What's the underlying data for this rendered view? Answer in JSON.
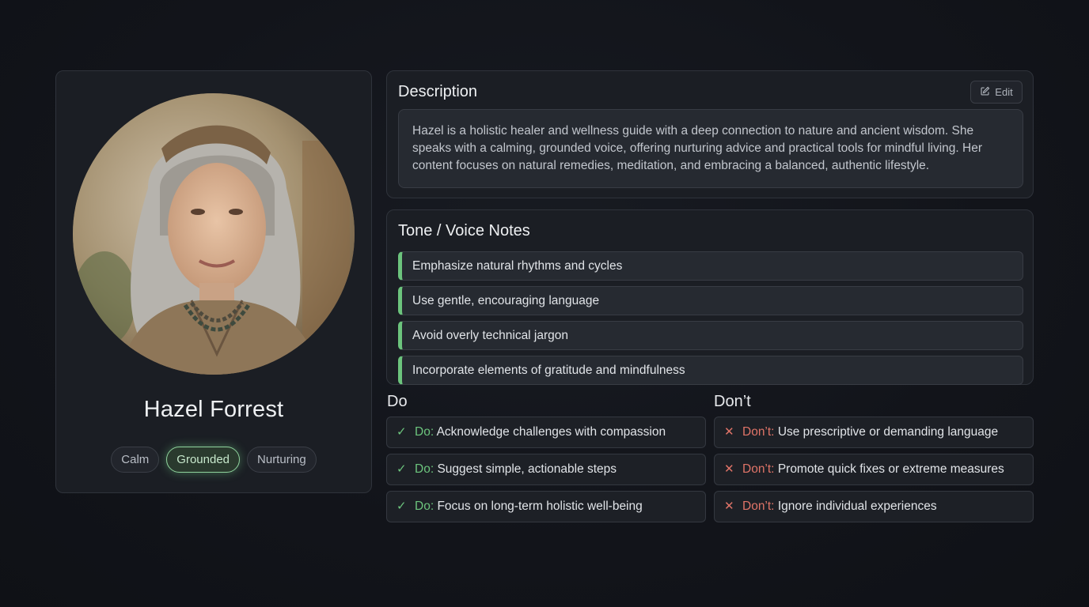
{
  "profile": {
    "name": "Hazel Forrest",
    "tags": [
      "Calm",
      "Grounded",
      "Nurturing"
    ],
    "active_tag": "Grounded"
  },
  "description": {
    "title": "Description",
    "edit_label": "Edit",
    "text": "Hazel is a holistic healer and wellness guide with a deep connection to nature and ancient wisdom. She speaks with a calming, grounded voice, offering nurturing advice and practical tools for mindful living. Her content focuses on natural remedies, meditation, and embracing a balanced, authentic lifestyle."
  },
  "tone": {
    "title": "Tone / Voice Notes",
    "notes": [
      "Emphasize natural rhythms and cycles",
      "Use gentle, encouraging language",
      "Avoid overly technical jargon",
      "Incorporate elements of gratitude and mindfulness"
    ]
  },
  "do": {
    "heading": "Do",
    "prefix": "Do:",
    "items": [
      "Acknowledge challenges with compassion",
      "Suggest simple, actionable steps",
      "Focus on long-term holistic well-being"
    ]
  },
  "dont": {
    "heading": "Don’t",
    "prefix": "Don’t:",
    "items": [
      "Use prescriptive or demanding language",
      "Promote quick fixes or extreme measures",
      "Ignore individual experiences"
    ]
  },
  "icons": {
    "edit": "pencil-square-icon",
    "do": "checkmark-icon",
    "dont": "x-mark-icon"
  },
  "colors": {
    "accent_green": "#6cc47d",
    "dont_red": "#e07468",
    "background": "#12141a",
    "panel": "#1b1e24"
  }
}
